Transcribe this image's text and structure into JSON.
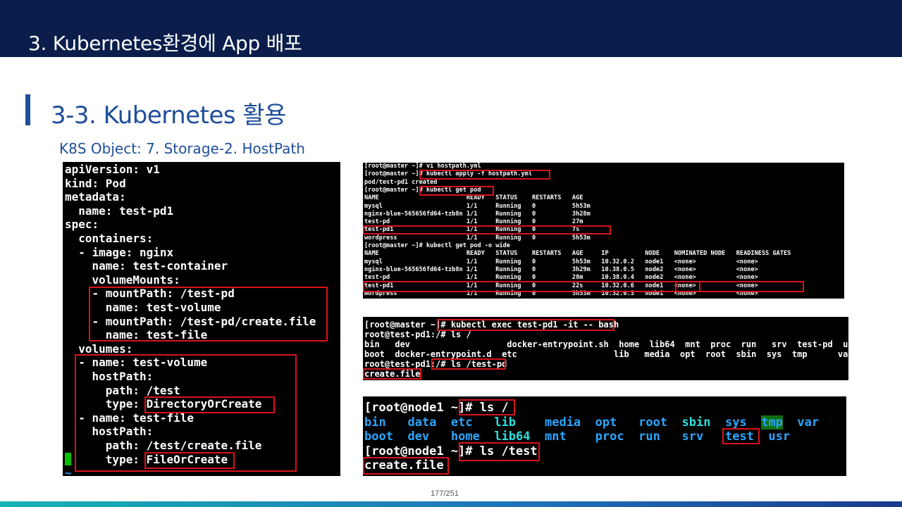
{
  "header": {
    "title": "3.  Kubernetes환경에 App 배포"
  },
  "section": {
    "title": "3-3. Kubernetes 활용",
    "subtitle": "K8S Object: 7. Storage-2. HostPath"
  },
  "yaml": {
    "lines": [
      "apiVersion: v1",
      "kind: Pod",
      "metadata:",
      "  name: test-pd1",
      "spec:",
      "  containers:",
      "  - image: nginx",
      "    name: test-container",
      "    volumeMounts:",
      "    - mountPath: /test-pd",
      "      name: test-volume",
      "    - mountPath: /test-pd/create.file",
      "      name: test-file",
      "  volumes:",
      "  - name: test-volume",
      "    hostPath:",
      "      path: /test",
      "      type: DirectoryOrCreate",
      "  - name: test-file",
      "    hostPath:",
      "      path: /test/create.file",
      "      type: FileOrCreate",
      "~"
    ]
  },
  "kubectl": {
    "lines": [
      "[root@master ~]# vi hostpath.yml",
      "[root@master ~]# kubectl apply -f hostpath.yml",
      "pod/test-pd1 created",
      "[root@master ~]# kubectl get pod",
      "NAME                        READY   STATUS    RESTARTS   AGE",
      "mysql                       1/1     Running   0          5h53m",
      "nginx-blue-565656fd64-tzb8n 1/1     Running   0          3h28m",
      "test-pd                     1/1     Running   0          27m",
      "test-pd1                    1/1     Running   0          7s",
      "wordpress                   1/1     Running   0          5h53m",
      "[root@master ~]# kubectl get pod -o wide",
      "NAME                        READY   STATUS    RESTARTS   AGE     IP          NODE    NOMINATED NODE   READINESS GATES",
      "mysql                       1/1     Running   0          5h53m   10.32.0.2   node1   <none>           <none>",
      "nginx-blue-565656fd64-tzb8n 1/1     Running   0          3h29m   10.38.0.5   node2   <none>           <none>",
      "test-pd                     1/1     Running   0          28m     10.38.0.4   node2   <none>           <none>",
      "test-pd1                    1/1     Running   0          22s     10.32.0.6   node1   <none>           <none>",
      "wordpress                   1/1     Running   0          5h53m   10.32.0.3   node1   <none>           <none>"
    ]
  },
  "exec": {
    "lines": [
      "[root@master ~]# kubectl exec test-pd1 -it -- bash",
      "root@test-pd1:/# ls /",
      "bin   dev                   docker-entrypoint.sh  home  lib64  mnt  proc  run   srv  test-pd  usr",
      "boot  docker-entrypoint.d  etc                   lib   media  opt  root  sbin  sys  tmp      var",
      "root@test-pd1:/# ls /test-pd",
      "create.file"
    ]
  },
  "node": {
    "prompt1": "[root@node1 ~]# ls /",
    "row1": [
      "bin",
      "data",
      "etc",
      "lib",
      "media",
      "opt",
      "root",
      "sbin",
      "sys",
      "tmp",
      "var"
    ],
    "row2": [
      "boot",
      "dev",
      "home",
      "lib64",
      "mnt",
      "proc",
      "run",
      "srv",
      "test",
      "usr"
    ],
    "prompt2": "[root@node1 ~]# ls /test",
    "output": "create.file"
  },
  "page_number": "177/251",
  "colors": {
    "header_bg": "#0b1e4b",
    "accent": "#1f4e9a",
    "highlight_box": "#d7141a",
    "cursor": "#00c000"
  }
}
